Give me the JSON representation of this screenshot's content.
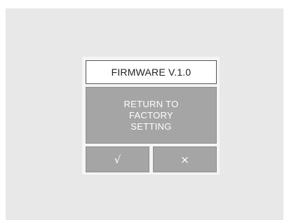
{
  "dialog": {
    "title": "FIRMWARE V.1.0",
    "message": "RETURN TO\nFACTORY\nSETTING",
    "confirm_label": "√",
    "cancel_label": "×"
  },
  "icons": {
    "confirm": "check-icon",
    "cancel": "close-icon"
  },
  "colors": {
    "screen_background": "#e8e8e8",
    "title_background": "#ffffff",
    "message_background": "#a5a5a5",
    "button_background": "#a5a5a5",
    "text_light": "#ffffff",
    "text_dark": "#222222"
  }
}
